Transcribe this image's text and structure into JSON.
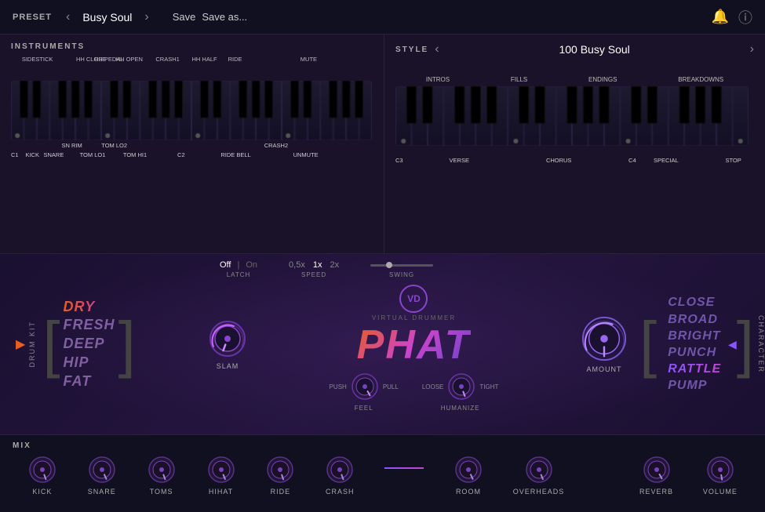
{
  "topbar": {
    "preset_label": "PRESET",
    "preset_name": "Busy Soul",
    "save_label": "Save",
    "save_as_label": "Save as..."
  },
  "instruments": {
    "title": "INSTRUMENTS",
    "top_labels": [
      {
        "text": "SIDESTICK",
        "pct": 3
      },
      {
        "text": "HH CLOSE",
        "pct": 19
      },
      {
        "text": "HH PEDAL",
        "pct": 24
      },
      {
        "text": "HH OPEN",
        "pct": 29
      },
      {
        "text": "CRASH1",
        "pct": 42
      },
      {
        "text": "HH HALF",
        "pct": 52
      },
      {
        "text": "RIDE",
        "pct": 60
      },
      {
        "text": "MUTE",
        "pct": 82
      }
    ],
    "bottom_labels": [
      {
        "text": "C1",
        "pct": 0,
        "row": "bot"
      },
      {
        "text": "KICK",
        "pct": 5,
        "row": "bot"
      },
      {
        "text": "SNARE",
        "pct": 10,
        "row": "bot"
      },
      {
        "text": "SN RIM",
        "pct": 15,
        "row": "top"
      },
      {
        "text": "TOM LO1",
        "pct": 21,
        "row": "bot"
      },
      {
        "text": "TOM LO2",
        "pct": 26,
        "row": "top"
      },
      {
        "text": "TOM HI1",
        "pct": 32,
        "row": "bot"
      },
      {
        "text": "C2",
        "pct": 47,
        "row": "bot"
      },
      {
        "text": "RIDE BELL",
        "pct": 60,
        "row": "bot"
      },
      {
        "text": "CRASH2",
        "pct": 72,
        "row": "top"
      },
      {
        "text": "UNMUTE",
        "pct": 80,
        "row": "bot"
      }
    ]
  },
  "style": {
    "title": "STYLE",
    "current": "100 Busy Soul",
    "top_labels": [
      "INTROS",
      "FILLS",
      "ENDINGS",
      "BREAKDOWNS"
    ],
    "bottom_labels": [
      "C3",
      "VERSE",
      "CHORUS",
      "SPECIAL",
      "C4",
      "STOP"
    ]
  },
  "controls": {
    "latch": {
      "off": "Off",
      "on": "On",
      "label": "LATCH"
    },
    "speed": {
      "options": [
        "0.5x",
        "1x",
        "2x"
      ],
      "active": "1x",
      "label": "SPEED"
    },
    "swing": {
      "label": "SWING"
    }
  },
  "drum_kit": {
    "label": "DRUM KIT",
    "names": [
      {
        "text": "DRY",
        "active": true
      },
      {
        "text": "FRESH",
        "active": false
      },
      {
        "text": "DEEP",
        "active": false
      },
      {
        "text": "HIP",
        "active": false
      },
      {
        "text": "FAT",
        "active": false
      }
    ],
    "slam_label": "SLAM"
  },
  "center": {
    "vd_text": "VD",
    "virtual_drummer": "VIRTUAL DRUMMER",
    "product_name": "PHAT",
    "feel_label": "FEEL",
    "humanize_label": "HUMANIZE",
    "push_label": "PUSH",
    "pull_label": "PULL",
    "loose_label": "LOOSE",
    "tight_label": "TIGHT"
  },
  "amount": {
    "label": "AMOUNT"
  },
  "character": {
    "label": "CHARACTER",
    "names": [
      {
        "text": "CLOSE",
        "active": false
      },
      {
        "text": "BROAD",
        "active": false
      },
      {
        "text": "BRIGHT",
        "active": false
      },
      {
        "text": "PUNCH",
        "active": false
      },
      {
        "text": "RATTLE",
        "active": true
      },
      {
        "text": "PUMP",
        "active": false
      }
    ]
  },
  "mix": {
    "title": "MIX",
    "knobs": [
      {
        "label": "KICK",
        "value": 0.5
      },
      {
        "label": "SNARE",
        "value": 0.5
      },
      {
        "label": "TOMS",
        "value": 0.5
      },
      {
        "label": "HIHAT",
        "value": 0.5
      },
      {
        "label": "RIDE",
        "value": 0.5
      },
      {
        "label": "CRASH",
        "value": 0.5
      },
      {
        "label": "ROOM",
        "value": 0.5
      },
      {
        "label": "OVERHEADS",
        "value": 0.5
      },
      {
        "label": "REVERB",
        "value": 0.5
      },
      {
        "label": "VOLUME",
        "value": 0.6
      }
    ]
  }
}
